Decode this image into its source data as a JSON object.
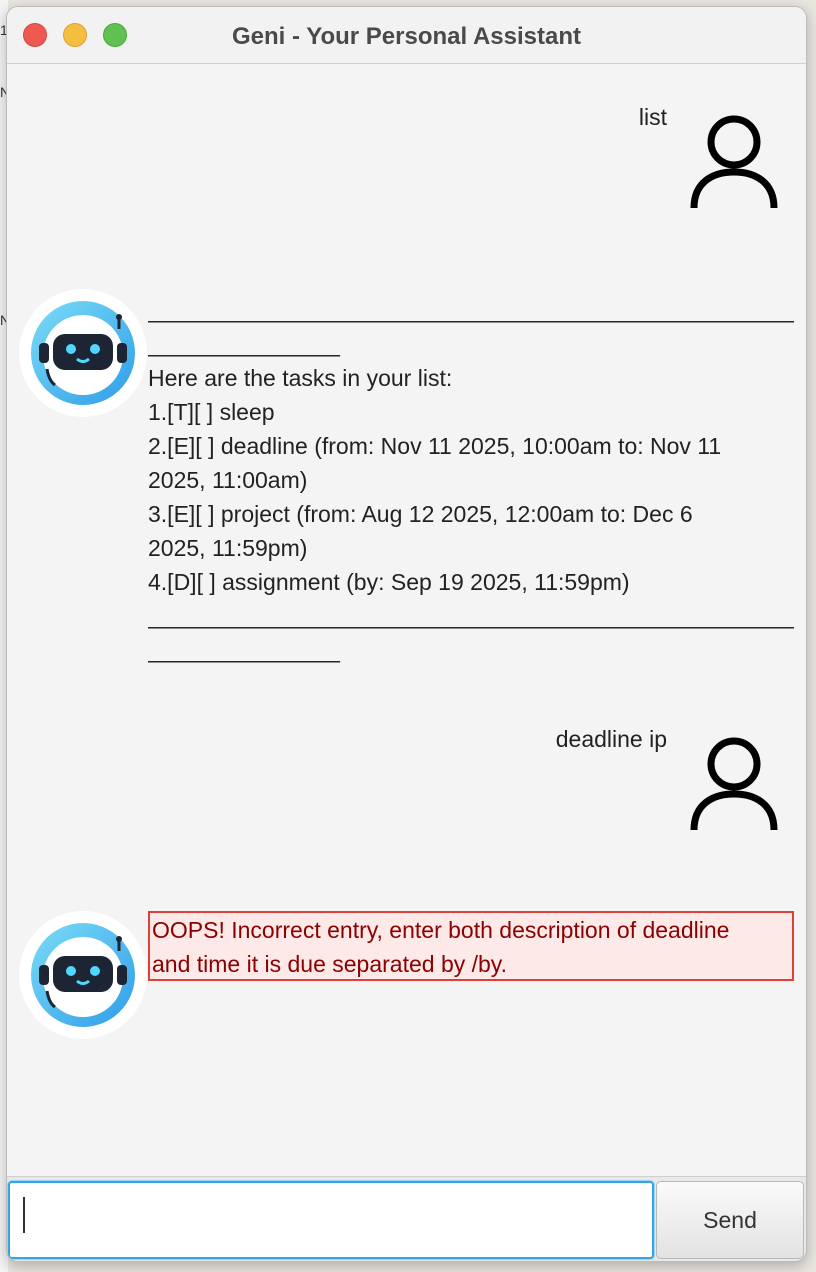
{
  "window": {
    "title": "Geni - Your Personal Assistant"
  },
  "background": {
    "fragment_1": "1",
    "fragment_2": "N",
    "fragment_3": "N"
  },
  "messages": [
    {
      "role": "user",
      "text": "list"
    },
    {
      "role": "bot",
      "lines": [
        "______________________________________________________",
        "_______________",
        "Here are the tasks in your list:",
        "1.[T][ ] sleep",
        "2.[E][ ] deadline (from: Nov 11 2025, 10:00am to: Nov 11",
        "2025, 11:00am)",
        "3.[E][ ] project (from: Aug 12 2025, 12:00am to: Dec 6",
        "2025, 11:59pm)",
        "4.[D][ ] assignment (by: Sep 19 2025, 11:59pm)",
        "______________________________________________________",
        "_______________"
      ]
    },
    {
      "role": "user",
      "text": "deadline ip"
    },
    {
      "role": "bot",
      "error": true,
      "lines": [
        "OOPS! Incorrect entry, enter both description of deadline",
        "and time it is due separated by /by."
      ]
    }
  ],
  "input": {
    "value": "",
    "placeholder": ""
  },
  "send_label": "Send",
  "colors": {
    "error_border": "#e0403a",
    "error_bg": "#fde9e8",
    "error_text": "#8b0000",
    "input_focus": "#34a6e6",
    "bot_blue": "#4cc3f2"
  },
  "icons": [
    "user-icon",
    "robot-avatar-icon"
  ]
}
